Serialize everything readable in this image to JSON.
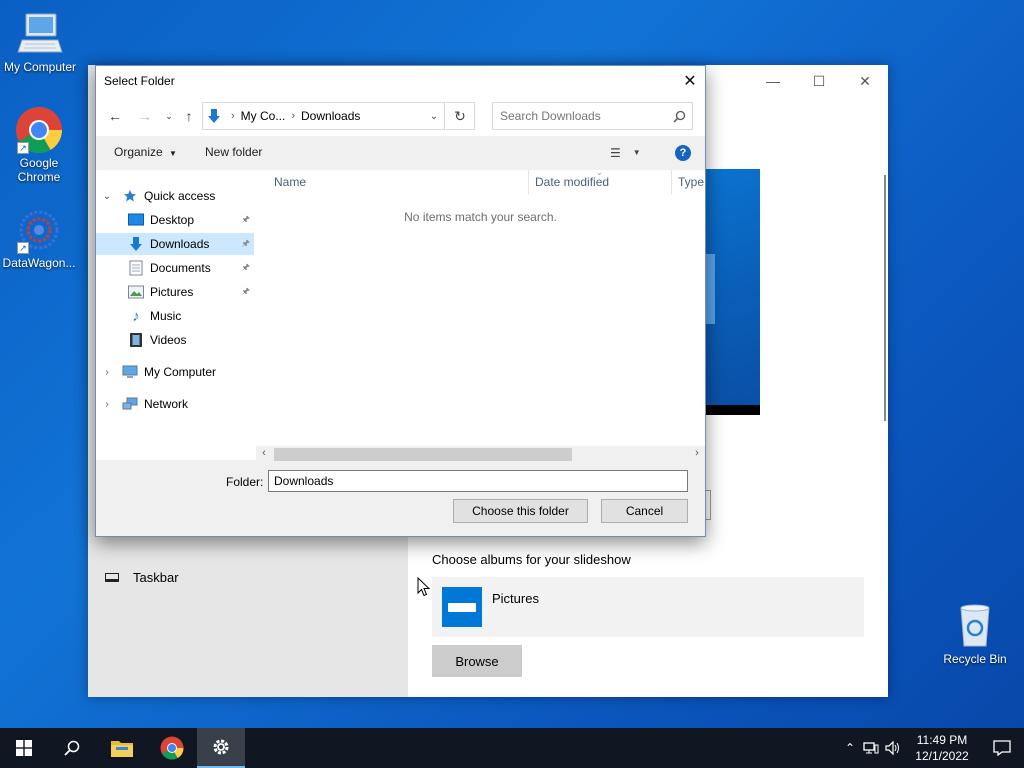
{
  "desktop": {
    "icons": [
      {
        "label": "My Computer"
      },
      {
        "label": "Google Chrome"
      },
      {
        "label": "DataWagon..."
      },
      {
        "label": "Recycle Bin"
      }
    ]
  },
  "settings": {
    "taskbar_label": "Taskbar",
    "albums_title": "Choose albums for your slideshow",
    "album_name": "Pictures",
    "browse_label": "Browse"
  },
  "dialog": {
    "title": "Select Folder",
    "address": {
      "parent": "My Co...",
      "current": "Downloads"
    },
    "search_placeholder": "Search Downloads",
    "commands": {
      "organize": "Organize",
      "new_folder": "New folder"
    },
    "nav": {
      "quick_access": "Quick access",
      "items": [
        "Desktop",
        "Downloads",
        "Documents",
        "Pictures",
        "Music",
        "Videos"
      ],
      "my_computer": "My Computer",
      "network": "Network"
    },
    "columns": {
      "name": "Name",
      "date_modified": "Date modified",
      "type": "Type"
    },
    "empty_message": "No items match your search.",
    "folder_label": "Folder:",
    "folder_value": "Downloads",
    "choose_button": "Choose this folder",
    "cancel_button": "Cancel"
  },
  "taskbar": {
    "time": "11:49 PM",
    "date": "12/1/2022"
  },
  "colors": {
    "accent": "#0078d7",
    "selection": "#cce8ff",
    "taskbar_bg": "#101723"
  }
}
